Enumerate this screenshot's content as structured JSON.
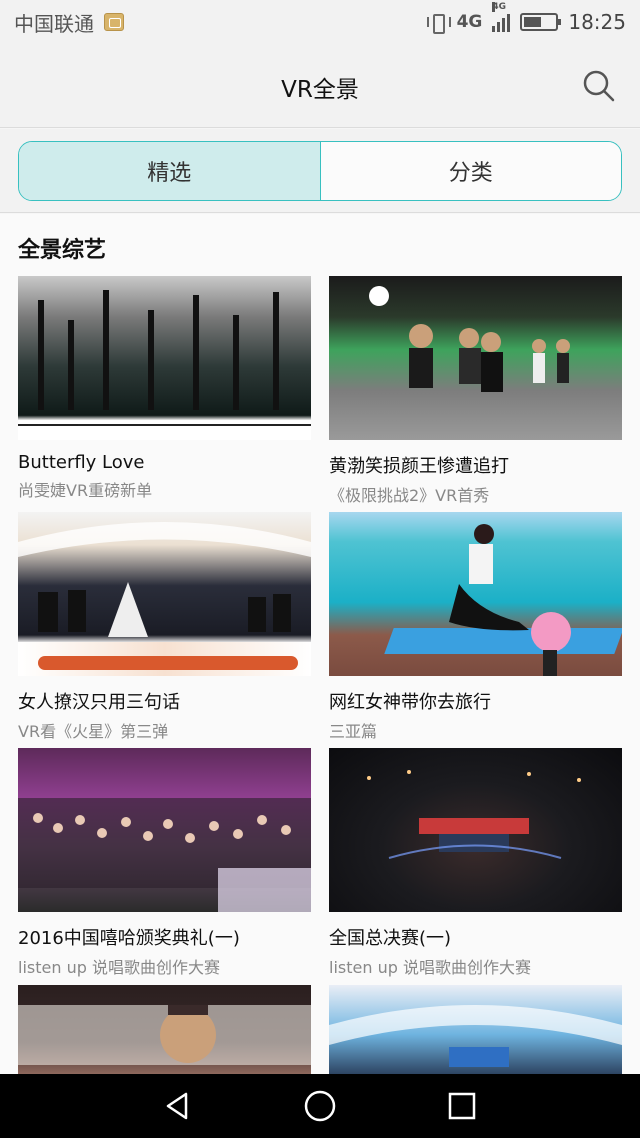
{
  "status_bar": {
    "carrier": "中国联通",
    "network": "4G",
    "network_small": "4G",
    "time": "18:25",
    "battery_level": 0.55
  },
  "header": {
    "title": "VR全景",
    "search_icon": "search-icon"
  },
  "tabs": [
    {
      "label": "精选",
      "active": true
    },
    {
      "label": "分类",
      "active": false
    }
  ],
  "section": {
    "title": "全景综艺"
  },
  "cards": [
    {
      "title": "Butterfly Love",
      "subtitle": "尚雯婕VR重磅新单"
    },
    {
      "title": "黄渤笑损颜王惨遭追打",
      "subtitle": "《极限挑战2》VR首秀"
    },
    {
      "title": "女人撩汉只用三句话",
      "subtitle": "VR看《火星》第三弹"
    },
    {
      "title": "网红女神带你去旅行",
      "subtitle": "三亚篇"
    },
    {
      "title": "2016中国嘻哈颁奖典礼(一)",
      "subtitle": "listen up 说唱歌曲创作大赛"
    },
    {
      "title": "全国总决赛(一)",
      "subtitle": "listen up 说唱歌曲创作大赛"
    },
    {
      "title": "",
      "subtitle": ""
    },
    {
      "title": "",
      "subtitle": ""
    }
  ],
  "nav": {
    "back_icon": "back-triangle-icon",
    "home_icon": "home-circle-icon",
    "recents_icon": "recents-square-icon"
  },
  "colors": {
    "accent": "#38c0c0",
    "tab_active_bg": "#cfecec"
  }
}
